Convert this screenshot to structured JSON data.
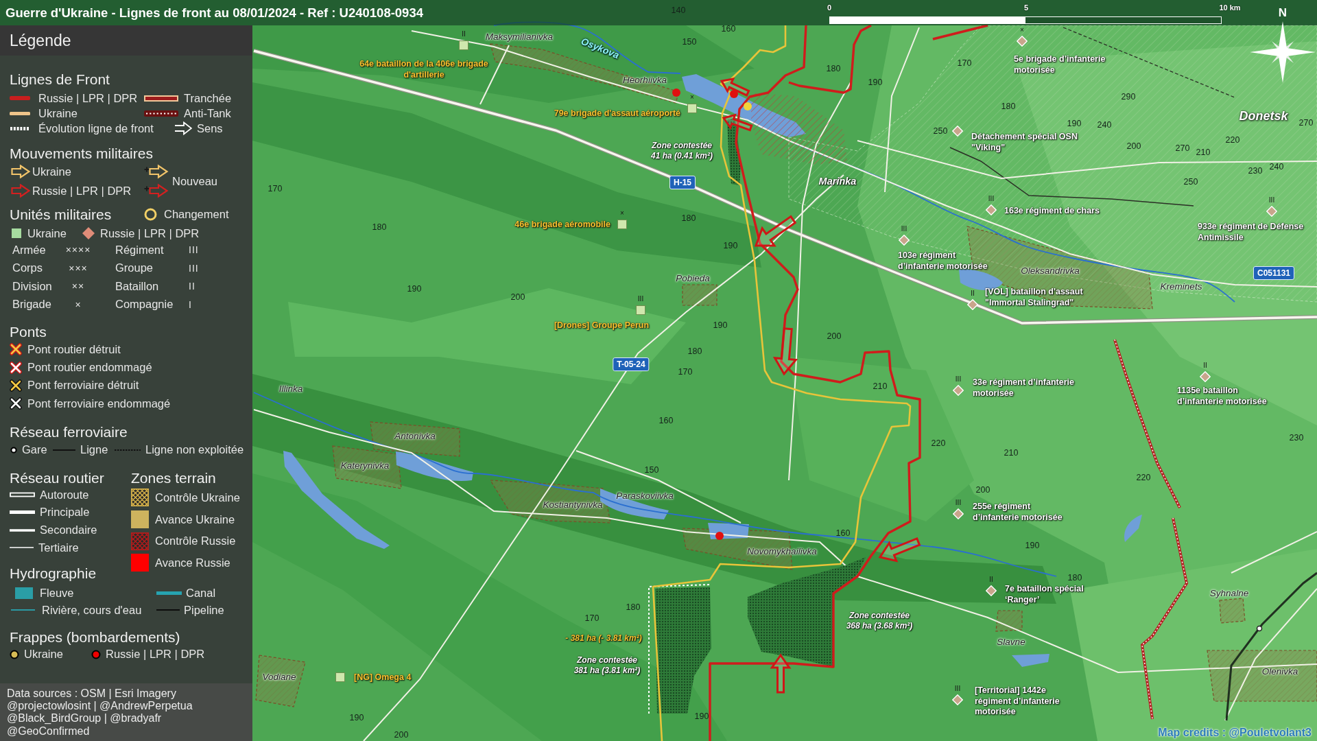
{
  "title": "Guerre d'Ukraine - Lignes de front au 08/01/2024 - Ref : U240108-0934",
  "scale_bar": {
    "labels": [
      "0",
      "5",
      "10 km"
    ]
  },
  "compass": {
    "label": "N"
  },
  "legend": {
    "title": "Légende",
    "front_lines": {
      "title": "Lignes de Front",
      "items": [
        {
          "label": "Russie | LPR | DPR",
          "kind": "russia"
        },
        {
          "label": "Tranchée",
          "kind": "trench"
        },
        {
          "label": "Ukraine",
          "kind": "ukraine"
        },
        {
          "label": "Anti-Tank",
          "kind": "antitank"
        },
        {
          "label": "Évolution ligne de front",
          "kind": "evolution"
        },
        {
          "label": "Sens",
          "kind": "direction"
        }
      ]
    },
    "movements": {
      "title": "Mouvements militaires",
      "items": [
        {
          "label": "Ukraine",
          "color": "#f2c46a"
        },
        {
          "label": "Russie | LPR | DPR",
          "color": "#d42020"
        }
      ],
      "new_label": "Nouveau"
    },
    "units": {
      "title": "Unités militaires",
      "change_label": "Changement",
      "sides": [
        {
          "label": "Ukraine",
          "kind": "ukraine"
        },
        {
          "label": "Russie | LPR | DPR",
          "kind": "russia"
        }
      ],
      "echelons": [
        {
          "label": "Armée",
          "symbol": "××××"
        },
        {
          "label": "Régiment",
          "symbol": "III"
        },
        {
          "label": "Corps",
          "symbol": "×××"
        },
        {
          "label": "Groupe",
          "symbol": "III"
        },
        {
          "label": "Division",
          "symbol": "××"
        },
        {
          "label": "Bataillon",
          "symbol": "II"
        },
        {
          "label": "Brigade",
          "symbol": "×"
        },
        {
          "label": "Compagnie",
          "symbol": "I"
        }
      ]
    },
    "bridges": {
      "title": "Ponts",
      "items": [
        {
          "label": "Pont routier détruit",
          "kind": "road",
          "color": "#f5c842"
        },
        {
          "label": "Pont routier endommagé",
          "kind": "road",
          "color": "#ffffff"
        },
        {
          "label": "Pont ferroviaire détruit",
          "kind": "rail",
          "color": "#f5c842"
        },
        {
          "label": "Pont ferroviaire endommagé",
          "kind": "rail",
          "color": "#ffffff"
        }
      ]
    },
    "railway": {
      "title": "Réseau ferroviaire",
      "items": [
        {
          "label": "Gare",
          "kind": "station"
        },
        {
          "label": "Ligne",
          "kind": "line"
        },
        {
          "label": "Ligne non exploitée",
          "kind": "disused"
        }
      ]
    },
    "roads": {
      "title": "Réseau routier",
      "items": [
        {
          "label": "Autoroute",
          "kind": "motorway"
        },
        {
          "label": "Principale",
          "kind": "primary"
        },
        {
          "label": "Secondaire",
          "kind": "secondary"
        },
        {
          "label": "Tertiaire",
          "kind": "tertiary"
        }
      ]
    },
    "zones": {
      "title": "Zones terrain",
      "items": [
        {
          "label": "Contrôle Ukraine",
          "kind": "hatched",
          "color": "#d9b44a"
        },
        {
          "label": "Avance Ukraine",
          "kind": "solid",
          "color": "#cdb35e"
        },
        {
          "label": "Contrôle Russie",
          "kind": "hatched",
          "color": "#b51c1c"
        },
        {
          "label": "Avance Russie",
          "kind": "solid",
          "color": "#ff0000"
        }
      ]
    },
    "hydrography": {
      "title": "Hydrographie",
      "items": [
        {
          "label": "Fleuve",
          "kind": "river"
        },
        {
          "label": "Canal",
          "kind": "canal"
        },
        {
          "label": "Rivière, cours d'eau",
          "kind": "stream"
        },
        {
          "label": "Pipeline",
          "kind": "pipeline"
        }
      ]
    },
    "strikes": {
      "title": "Frappes (bombardements)",
      "items": [
        {
          "label": "Ukraine",
          "color": "#d6bb55"
        },
        {
          "label": "Russie | LPR | DPR",
          "color": "#ee0000"
        }
      ]
    },
    "sources": [
      "Data sources : OSM | Esri Imagery",
      "@projectowlosint | @AndrewPerpetua",
      "@Black_BirdGroup | @bradyafr",
      "@GeoConfirmed"
    ]
  },
  "map": {
    "places": [
      {
        "name": "Maksymilianivka",
        "kind": "village"
      },
      {
        "name": "Osykova",
        "kind": "river"
      },
      {
        "name": "Heorhiivka",
        "kind": "village"
      },
      {
        "name": "Marinka",
        "kind": "town"
      },
      {
        "name": "Pobieda",
        "kind": "village"
      },
      {
        "name": "Oleksandrivka",
        "kind": "village"
      },
      {
        "name": "Kreminets",
        "kind": "village"
      },
      {
        "name": "Donetsk",
        "kind": "city"
      },
      {
        "name": "Illinka",
        "kind": "village"
      },
      {
        "name": "Antonivka",
        "kind": "village"
      },
      {
        "name": "Katerynivka",
        "kind": "village"
      },
      {
        "name": "Kostiantynivka",
        "kind": "village"
      },
      {
        "name": "Paraskoviivka",
        "kind": "village"
      },
      {
        "name": "Novomykhailivka",
        "kind": "village"
      },
      {
        "name": "Vodiane",
        "kind": "village"
      },
      {
        "name": "Slavne",
        "kind": "village"
      },
      {
        "name": "Syhnalne",
        "kind": "village"
      },
      {
        "name": "Olenivka",
        "kind": "village"
      }
    ],
    "elevations": [
      "140",
      "160",
      "150",
      "180",
      "190",
      "170",
      "180",
      "290",
      "190",
      "240",
      "250",
      "220",
      "200",
      "270",
      "210",
      "270",
      "240",
      "230",
      "250",
      "170",
      "180",
      "180",
      "190",
      "190",
      "200",
      "190",
      "200",
      "180",
      "170",
      "210",
      "160",
      "230",
      "220",
      "210",
      "150",
      "220",
      "200",
      "160",
      "190",
      "180",
      "180",
      "170",
      "190",
      "190",
      "200"
    ],
    "road_refs": [
      "H-15",
      "T-05-24",
      "C051131"
    ],
    "units": [
      {
        "kind": "ukraine",
        "echelon": "II",
        "lines": [
          "64e bataillon de la 406e brigade",
          "d'artillerie"
        ]
      },
      {
        "kind": "ukraine",
        "echelon": "×",
        "lines": [
          "79e brigade d'assaut aéroporté"
        ]
      },
      {
        "kind": "ukraine",
        "echelon": "×",
        "lines": [
          "46e brigade aéromobile"
        ]
      },
      {
        "kind": "ukraine",
        "echelon": "III",
        "lines": [
          "[Drones] Groupe Perun"
        ]
      },
      {
        "kind": "ukraine",
        "lines": [
          "[NG] Omega 4"
        ]
      },
      {
        "kind": "russia",
        "echelon": "×",
        "lines": [
          "5e brigade d’infanterie",
          "motorisée"
        ]
      },
      {
        "kind": "russia",
        "lines": [
          "Détachement spécial OSN",
          "\"Viking\""
        ]
      },
      {
        "kind": "russia",
        "echelon": "III",
        "lines": [
          "163e régiment de chars"
        ]
      },
      {
        "kind": "russia",
        "echelon": "III",
        "lines": [
          "103e régiment",
          "d’infanterie motorisée"
        ]
      },
      {
        "kind": "russia",
        "echelon": "II",
        "lines": [
          "[VOL] bataillon d'assaut",
          "\"Immortal Stalingrad\""
        ]
      },
      {
        "kind": "russia",
        "echelon": "III",
        "lines": [
          "933e régiment de Défense",
          "Antimissile"
        ]
      },
      {
        "kind": "russia",
        "echelon": "III",
        "lines": [
          "33e régiment d’infanterie",
          "motorisée"
        ]
      },
      {
        "kind": "russia",
        "echelon": "II",
        "lines": [
          "1135e bataillon",
          "d’infanterie motorisée"
        ]
      },
      {
        "kind": "russia",
        "echelon": "III",
        "lines": [
          "255e régiment",
          "d’infanterie motorisée"
        ]
      },
      {
        "kind": "russia",
        "echelon": "II",
        "lines": [
          "7e bataillon spécial",
          "‘Ranger’"
        ]
      },
      {
        "kind": "russia",
        "echelon": "III",
        "lines": [
          "[Territorial] 1442e",
          "régiment d’infanterie",
          "motorisée"
        ]
      }
    ],
    "zone_notes": [
      {
        "kind": "contested",
        "lines": [
          "Zone contestée",
          "41 ha (0.41 km²)"
        ]
      },
      {
        "kind": "change",
        "lines": [
          "- 381 ha (- 3.81 km²)"
        ]
      },
      {
        "kind": "contested",
        "lines": [
          "Zone contestée",
          "381 ha (3.81 km²)"
        ]
      },
      {
        "kind": "contested",
        "lines": [
          "Zone contestée",
          "368 ha (3.68 km²)"
        ]
      }
    ],
    "strikes": [
      {
        "color": "#e01010"
      },
      {
        "color": "#e01010"
      },
      {
        "color": "#e01010"
      },
      {
        "color": "#f2d43a"
      }
    ],
    "credits": "Map credits : @Pouletvolant3"
  }
}
